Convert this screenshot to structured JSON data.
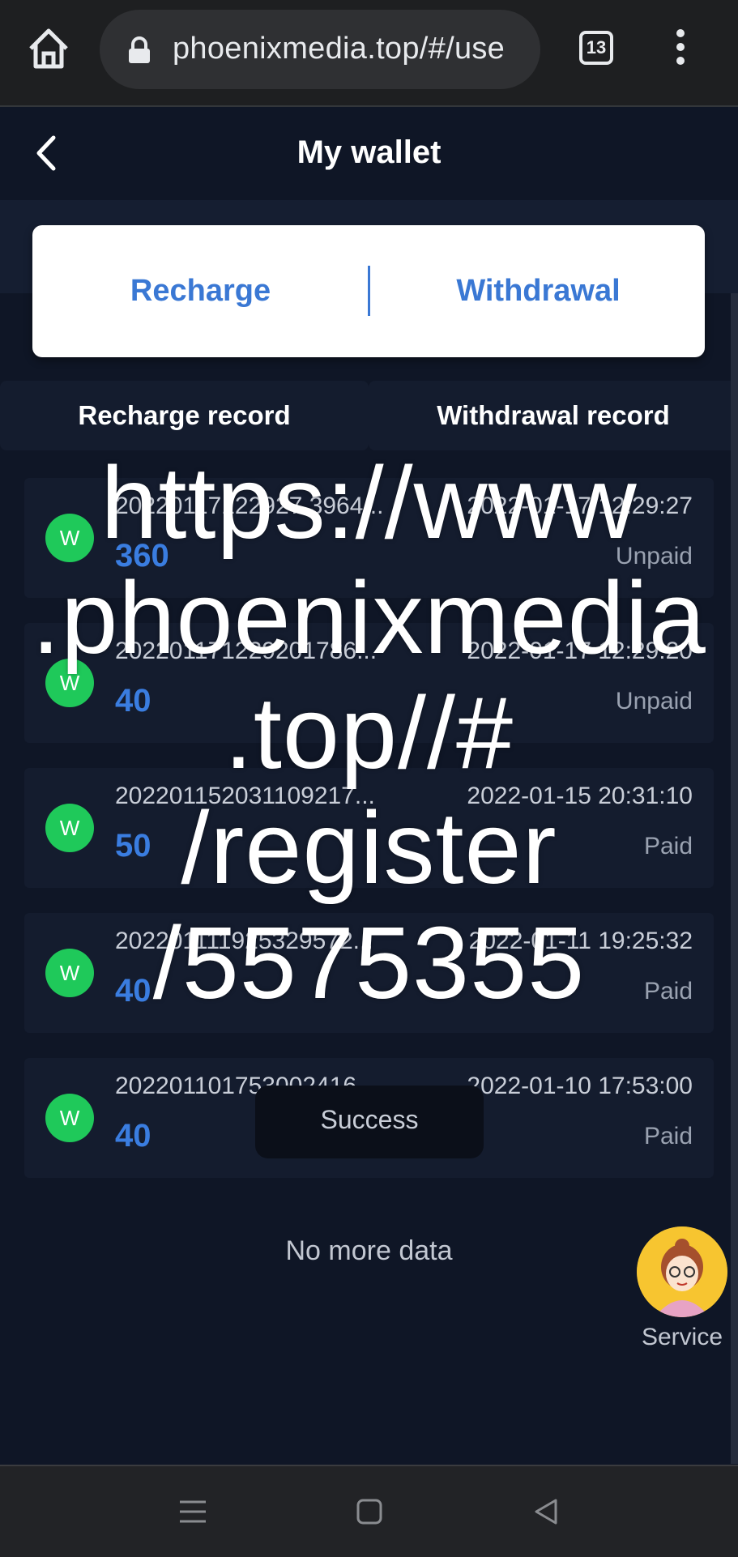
{
  "browser": {
    "url": "phoenixmedia.top/#/use",
    "tab_count": "13"
  },
  "header": {
    "title": "My wallet"
  },
  "actions": {
    "recharge": "Recharge",
    "withdrawal": "Withdrawal"
  },
  "record_tabs": {
    "recharge_record": "Recharge record",
    "withdrawal_record": "Withdrawal record"
  },
  "records": [
    {
      "icon": "W",
      "id": "20220117122927 3964...",
      "time": "2022-01-17 12:29:27",
      "amount": "360",
      "status": "Unpaid"
    },
    {
      "icon": "W",
      "id": "202201171229201786...",
      "time": "2022-01-17 12:29:20",
      "amount": "40",
      "status": "Unpaid"
    },
    {
      "icon": "W",
      "id": "202201152031109217...",
      "time": "2022-01-15 20:31:10",
      "amount": "50",
      "status": "Paid"
    },
    {
      "icon": "W",
      "id": "202201111925329572...",
      "time": "2022-01-11 19:25:32",
      "amount": "40",
      "status": "Paid"
    },
    {
      "icon": "W",
      "id": "202201101753002416...",
      "time": "2022-01-10 17:53:00",
      "amount": "40",
      "status": "Paid"
    }
  ],
  "toast": "Success",
  "footer_text": "No more data",
  "service": {
    "label": "Service"
  },
  "watermark": {
    "lines": [
      "https://www",
      ".phoenixmedia",
      ".top//#",
      "/register",
      "/5575355"
    ]
  },
  "colors": {
    "background": "#0f1626",
    "card": "#141c2e",
    "accent_blue": "#3a78d4",
    "icon_green": "#1fc95a"
  }
}
